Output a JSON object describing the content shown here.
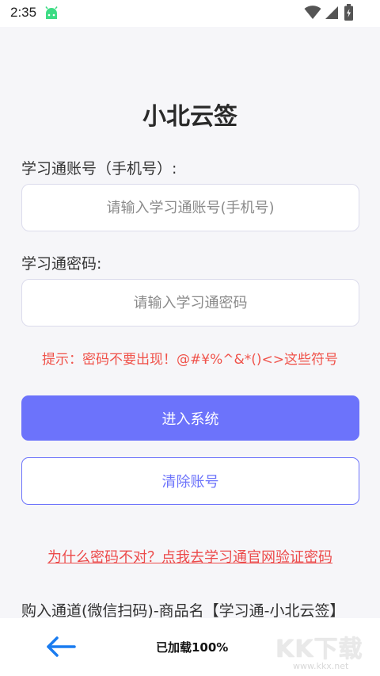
{
  "status_bar": {
    "time": "2:35",
    "icons": [
      "android-icon",
      "wifi-icon",
      "signal-icon",
      "battery-icon"
    ]
  },
  "login": {
    "title": "小北云签",
    "account_label": "学习通账号（手机号）:",
    "account_placeholder": "请输入学习通账号(手机号)",
    "account_value": "",
    "password_label": "学习通密码:",
    "password_placeholder": "请输入学习通密码",
    "password_value": "",
    "tip": "提示：密码不要出现！@#¥%^&*()<>这些符号",
    "login_button": "进入系统",
    "clear_button": "清除账号",
    "verify_link": "为什么密码不对？点我去学习通官网验证密码",
    "purchase_channel": "购入通道(微信扫码)-商品名【学习通-小北云签】"
  },
  "bottom_bar": {
    "load_status": "已加载100%",
    "watermark": "KK下载",
    "watermark_url": "www.kkx.net"
  },
  "colors": {
    "accent": "#6c73fb",
    "warning": "#f0524a",
    "link": "#ec4a4a",
    "background": "#f6f6f9",
    "back_arrow": "#1a7cf0"
  }
}
